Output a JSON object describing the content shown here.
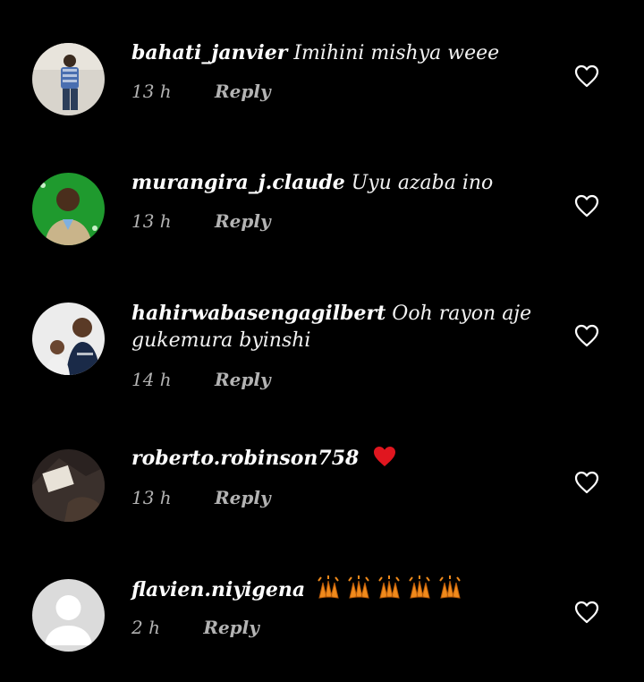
{
  "comments": [
    {
      "username": "bahati_janvier",
      "text": "Imihini mishya weee",
      "time": "13 h",
      "reply": "Reply"
    },
    {
      "username": "murangira_j.claude",
      "text": "Uyu azaba ino",
      "time": "13 h",
      "reply": "Reply"
    },
    {
      "username": "hahirwabasengagilbert",
      "text": "Ooh rayon  aje gukemura byinshi",
      "time": "14 h",
      "reply": "Reply"
    },
    {
      "username": "roberto.robinson758",
      "text": "",
      "emoji": "heart",
      "time": "13 h",
      "reply": "Reply"
    },
    {
      "username": "flavien.niyigena",
      "text": "",
      "emoji": "clapping-hands x5",
      "time": "2 h",
      "reply": "Reply"
    }
  ],
  "colors": {
    "background": "#000000",
    "username": "#ffffff",
    "meta": "#b3b3b3",
    "heart_emoji": "#e0161f",
    "clap_emoji": "#f08a1c"
  },
  "icons": {
    "like": "heart-outline-icon",
    "default_avatar": "default-avatar-icon"
  }
}
